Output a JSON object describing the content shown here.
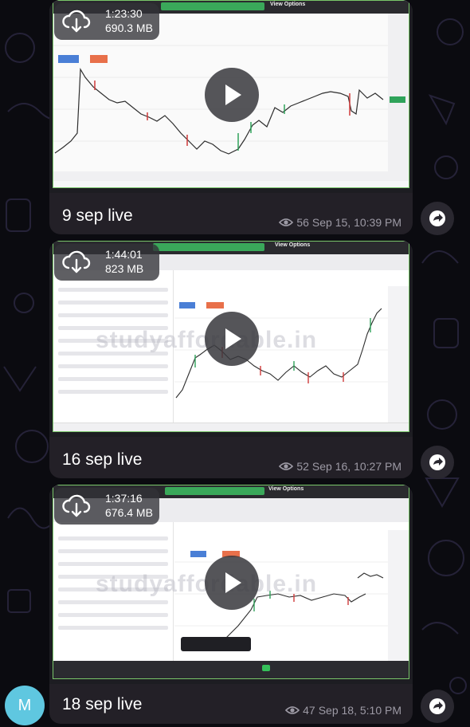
{
  "messages": [
    {
      "duration": "1:23:30",
      "size": "690.3 MB",
      "caption": "9 sep live",
      "views": "56",
      "timestamp": "Sep 15, 10:39 PM",
      "banner_view_options": "View Options"
    },
    {
      "duration": "1:44:01",
      "size": "823 MB",
      "caption": "16 sep live",
      "views": "52",
      "timestamp": "Sep 16, 10:27 PM",
      "banner_view_options": "View Options",
      "watermark": "studyaffordable.in"
    },
    {
      "duration": "1:37:16",
      "size": "676.4 MB",
      "caption": "18 sep live",
      "views": "47",
      "timestamp": "Sep 18, 5:10 PM",
      "banner_view_options": "View Options",
      "watermark": "studyaffordable.in"
    }
  ],
  "avatar_initial": "M",
  "icons": {
    "download": "cloud-download-icon",
    "play": "play-icon",
    "views": "eye-icon",
    "share": "share-arrow-icon"
  },
  "colors": {
    "bubble": "#232027",
    "accent_green": "#79c76a",
    "avatar": "#5fc7e0",
    "meta_text": "#9d9aa5"
  }
}
